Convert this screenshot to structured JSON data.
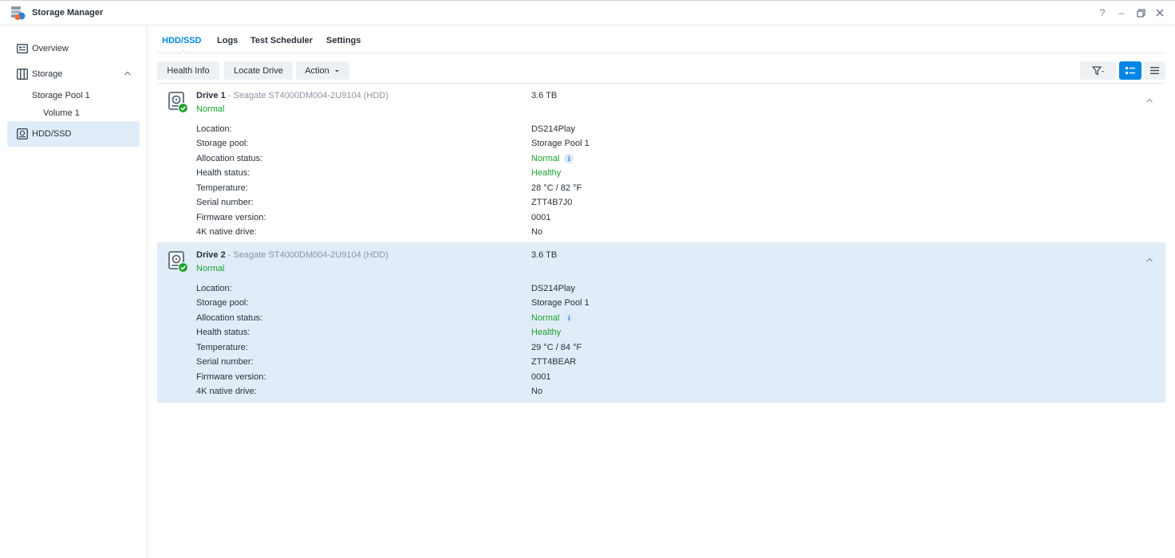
{
  "app": {
    "title": "Storage Manager",
    "help": "?",
    "minimize": "–",
    "restore": "⧉",
    "close": "✕"
  },
  "sidebar": {
    "overview": "Overview",
    "storage": "Storage",
    "storage_pool": "Storage Pool 1",
    "volume": "Volume 1",
    "hdd_ssd": "HDD/SSD"
  },
  "tabs": [
    "HDD/SSD",
    "Logs",
    "Test Scheduler",
    "Settings"
  ],
  "toolbar": {
    "health_info": "Health Info",
    "locate_drive": "Locate Drive",
    "action": "Action"
  },
  "labels": {
    "location": "Location:",
    "storage_pool": "Storage pool:",
    "allocation": "Allocation status:",
    "health": "Health status:",
    "temperature": "Temperature:",
    "serial": "Serial number:",
    "firmware": "Firmware version:",
    "native4k": "4K native drive:"
  },
  "drives": [
    {
      "name": "Drive 1",
      "model": " - Seagate ST4000DM004-2U9104 (HDD)",
      "status": "Normal",
      "size": "3.6 TB",
      "location": "DS214Play",
      "storage_pool": "Storage Pool 1",
      "allocation": "Normal",
      "health": "Healthy",
      "temperature": "28 °C / 82 °F",
      "serial": "ZTT4B7J0",
      "firmware": "0001",
      "native4k": "No"
    },
    {
      "name": "Drive 2",
      "model": " - Seagate ST4000DM004-2U9104 (HDD)",
      "status": "Normal",
      "size": "3.6 TB",
      "location": "DS214Play",
      "storage_pool": "Storage Pool 1",
      "allocation": "Normal",
      "health": "Healthy",
      "temperature": "29 °C / 84 °F",
      "serial": "ZTT4BEAR",
      "firmware": "0001",
      "native4k": "No"
    }
  ],
  "info_glyph": "i",
  "colors": {
    "accent": "#0086e5",
    "healthy": "#1aa32b",
    "selected_bg": "#e1ecf9"
  }
}
